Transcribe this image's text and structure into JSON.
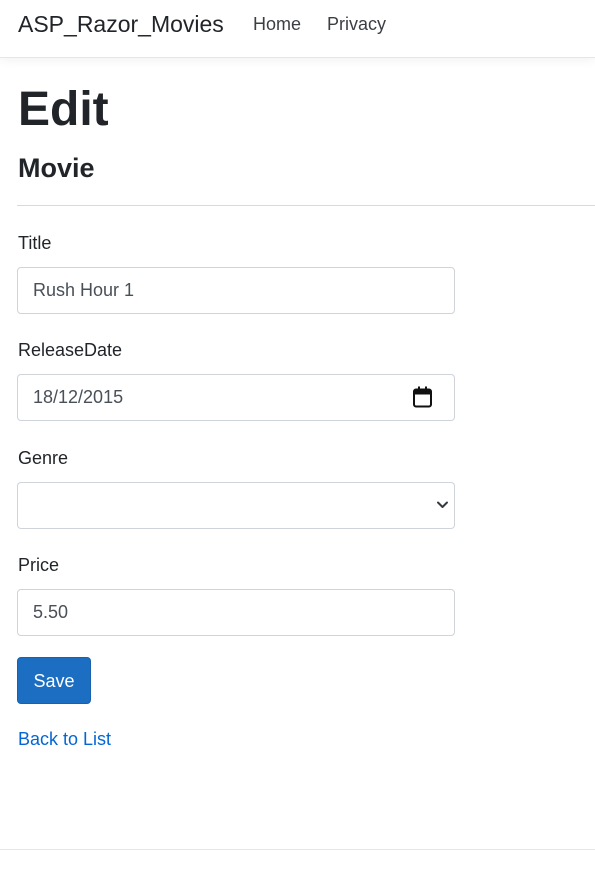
{
  "navbar": {
    "brand": "ASP_Razor_Movies",
    "links": [
      {
        "label": "Home"
      },
      {
        "label": "Privacy"
      }
    ]
  },
  "page": {
    "title": "Edit",
    "section_title": "Movie"
  },
  "form": {
    "fields": [
      {
        "label": "Title",
        "value": "Rush Hour 1"
      },
      {
        "label": "ReleaseDate",
        "value": "18/12/2015",
        "icon": "calendar-icon"
      },
      {
        "label": "Genre",
        "value": "",
        "icon": "chevron-down-icon"
      },
      {
        "label": "Price",
        "value": "5.50"
      }
    ],
    "save_label": "Save",
    "back_label": "Back to List"
  },
  "colors": {
    "primary_button": "#1b6ec2",
    "link": "#0366d6",
    "border": "#ced4da",
    "text": "#212529"
  }
}
